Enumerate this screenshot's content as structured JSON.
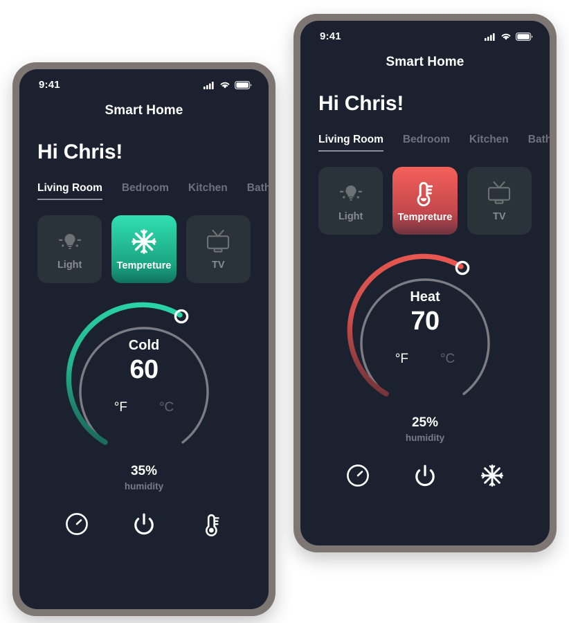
{
  "page": {
    "background": "#ffffff",
    "screen_bg": "#1c2130",
    "bezel_color": "#7d7672",
    "card_bg": "#2b333a",
    "accent_cold": "#2ccfa3",
    "accent_heat": "#ef5350",
    "muted_text": "#6d7280"
  },
  "phones": [
    {
      "id": "phone-left",
      "status": {
        "time": "9:41",
        "icons": [
          "signal-icon",
          "wifi-icon",
          "battery-icon"
        ]
      },
      "app_title": "Smart Home",
      "greeting": "Hi Chris!",
      "tabs": [
        {
          "label": "Living Room",
          "active": true
        },
        {
          "label": "Bedroom",
          "active": false
        },
        {
          "label": "Kitchen",
          "active": false
        },
        {
          "label": "Bathro",
          "active": false
        }
      ],
      "cards": [
        {
          "label": "Light",
          "icon": "light-bulb-icon",
          "state": "inactive"
        },
        {
          "label": "Tempreture",
          "icon": "snowflake-icon",
          "state": "active-cold"
        },
        {
          "label": "TV",
          "icon": "tv-icon",
          "state": "inactive"
        }
      ],
      "dial": {
        "mode": "Cold",
        "value": "60",
        "units": [
          {
            "label": "°F",
            "selected": true
          },
          {
            "label": "°C",
            "selected": false
          }
        ],
        "arc_color_start": "#2ad3a5",
        "arc_color_end": "#1b6255",
        "track_color": "#7d7c84",
        "knob_color": "#ffffff",
        "progress_percent": 72
      },
      "humidity": {
        "value": "35%",
        "label": "humidity"
      },
      "actions": [
        {
          "icon": "timer-icon",
          "name": "timer-button"
        },
        {
          "icon": "power-icon",
          "name": "power-button"
        },
        {
          "icon": "thermometer-icon",
          "name": "thermometer-button"
        }
      ]
    },
    {
      "id": "phone-right",
      "status": {
        "time": "9:41",
        "icons": [
          "signal-icon",
          "wifi-icon",
          "battery-icon"
        ]
      },
      "app_title": "Smart Home",
      "greeting": "Hi Chris!",
      "tabs": [
        {
          "label": "Living Room",
          "active": true
        },
        {
          "label": "Bedroom",
          "active": false
        },
        {
          "label": "Kitchen",
          "active": false
        },
        {
          "label": "Bathro",
          "active": false
        }
      ],
      "cards": [
        {
          "label": "Light",
          "icon": "light-bulb-icon",
          "state": "inactive"
        },
        {
          "label": "Tempreture",
          "icon": "thermometer-icon",
          "state": "active-heat"
        },
        {
          "label": "TV",
          "icon": "tv-icon",
          "state": "inactive"
        }
      ],
      "dial": {
        "mode": "Heat",
        "value": "70",
        "units": [
          {
            "label": "°F",
            "selected": true
          },
          {
            "label": "°C",
            "selected": false
          }
        ],
        "arc_color_start": "#e8574f",
        "arc_color_end": "#6b3238",
        "track_color": "#7d7c84",
        "knob_color": "#ffffff",
        "progress_percent": 72
      },
      "humidity": {
        "value": "25%",
        "label": "humidity"
      },
      "actions": [
        {
          "icon": "timer-icon",
          "name": "timer-button"
        },
        {
          "icon": "power-icon",
          "name": "power-button"
        },
        {
          "icon": "snowflake-icon",
          "name": "snowflake-button"
        }
      ]
    }
  ]
}
